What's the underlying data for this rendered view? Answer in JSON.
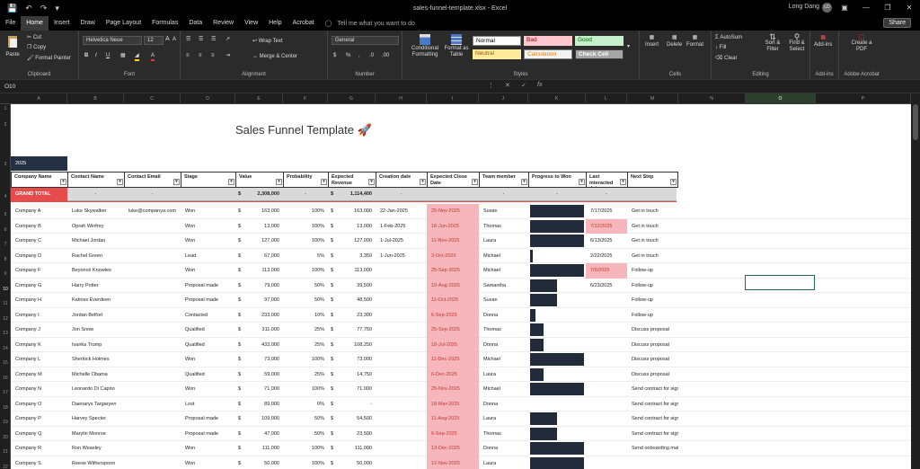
{
  "window": {
    "doc_title": "sales-funnel-template.xlsx  -  Excel",
    "user_name": "Long Dang",
    "user_initials": "LD"
  },
  "tabs": [
    "File",
    "Home",
    "Insert",
    "Draw",
    "Page Layout",
    "Formulas",
    "Data",
    "Review",
    "View",
    "Help",
    "Acrobat"
  ],
  "tell_me": "Tell me what you want to do",
  "share_label": "Share",
  "ribbon": {
    "clipboard": {
      "label": "Clipboard",
      "paste": "Paste",
      "cut": "Cut",
      "copy": "Copy",
      "format_painter": "Format Painter"
    },
    "font": {
      "label": "Font",
      "name": "Helvetica Neue",
      "size": "12"
    },
    "alignment": {
      "label": "Alignment",
      "wrap": "Wrap Text",
      "merge": "Merge & Center"
    },
    "number": {
      "label": "Number",
      "format": "General"
    },
    "styles": {
      "label": "Styles",
      "conditional": "Conditional Formatting",
      "format_table": "Format as Table",
      "normal": "Normal",
      "bad": "Bad",
      "good": "Good",
      "neutral": "Neutral",
      "calculation": "Calculation",
      "check_cell": "Check Cell"
    },
    "cells": {
      "label": "Cells",
      "insert": "Insert",
      "delete": "Delete",
      "format": "Format"
    },
    "editing": {
      "label": "Editing",
      "autosum": "AutoSum",
      "fill": "Fill",
      "clear": "Clear",
      "sort": "Sort & Filter",
      "find": "Find & Select"
    },
    "addins": {
      "label": "Add-ins",
      "btn": "Add-ins"
    },
    "acrobat": {
      "label": "Adobe Acrobat",
      "btn": "Create a PDF"
    }
  },
  "name_box": "O10",
  "columns": [
    "A",
    "B",
    "C",
    "D",
    "E",
    "F",
    "G",
    "H",
    "I",
    "J",
    "K",
    "L",
    "M",
    "N",
    "O",
    "P"
  ],
  "rows": [
    "1",
    "2",
    "3",
    "4",
    "5",
    "6",
    "7",
    "8",
    "9",
    "10",
    "11",
    "12",
    "13",
    "14",
    "15",
    "16",
    "17",
    "18",
    "19",
    "20",
    "21",
    "22"
  ],
  "sheet": {
    "title": "Sales Funnel Template 🚀",
    "year": "2025",
    "headers": [
      "Company Name",
      "Contact Name",
      "Contact Email",
      "Stage",
      "Value",
      "Probability",
      "Expected Revenue",
      "Creation date",
      "Expected Close Date",
      "Team member",
      "Progress to Won",
      "Last interacted date",
      "Next Step"
    ],
    "grand_total": {
      "label": "GRAND TOTAL",
      "value": "2,308,000",
      "revenue": "1,114,400"
    },
    "data": [
      {
        "company": "Company A",
        "contact": "Luke Skywalker",
        "email": "luke@companya.com",
        "stage": "Won",
        "value": "163,000",
        "prob": "100%",
        "rev": "163,000",
        "created": "22-Jan-2025",
        "close": "25-Nov-2025",
        "member": "Susan",
        "progress": 1.0,
        "last": "7/17/2025",
        "last_hl": false,
        "next": "Get in touch"
      },
      {
        "company": "Company B",
        "contact": "Oprah Winfrey",
        "email": "",
        "stage": "Won",
        "value": "13,000",
        "prob": "100%",
        "rev": "13,000",
        "created": "1-Feb-2025",
        "close": "18-Jun-2025",
        "member": "Thomas",
        "progress": 1.0,
        "last": "7/12/2025",
        "last_hl": true,
        "next": "Get in touch"
      },
      {
        "company": "Company C",
        "contact": "Michael Jordan",
        "email": "",
        "stage": "Won",
        "value": "127,000",
        "prob": "100%",
        "rev": "127,000",
        "created": "1-Jul-2025",
        "close": "11-Nov-2025",
        "member": "Laura",
        "progress": 1.0,
        "last": "6/13/2025",
        "last_hl": false,
        "next": "Get in touch"
      },
      {
        "company": "Company D",
        "contact": "Rachel Green",
        "email": "",
        "stage": "Lead",
        "value": "67,000",
        "prob": "5%",
        "rev": "3,350",
        "created": "1-Jun-2025",
        "close": "3-Oct-2025",
        "member": "Michael",
        "progress": 0.05,
        "last": "2/22/2025",
        "last_hl": false,
        "next": "Get in touch"
      },
      {
        "company": "Company F",
        "contact": "Beyoncé Knowles",
        "email": "",
        "stage": "Won",
        "value": "113,000",
        "prob": "100%",
        "rev": "113,000",
        "created": "",
        "close": "25-Sep-2025",
        "member": "Michael",
        "progress": 1.0,
        "last": "7/5/2025",
        "last_hl": true,
        "next": "Follow-up"
      },
      {
        "company": "Company G",
        "contact": "Harry Potter",
        "email": "",
        "stage": "Proposal made",
        "value": "79,000",
        "prob": "50%",
        "rev": "39,500",
        "created": "",
        "close": "19-Aug-2025",
        "member": "Samantha",
        "progress": 0.5,
        "last": "6/23/2025",
        "last_hl": false,
        "next": "Follow-up"
      },
      {
        "company": "Company H",
        "contact": "Katniss Everdeen",
        "email": "",
        "stage": "Proposal made",
        "value": "97,000",
        "prob": "50%",
        "rev": "48,500",
        "created": "",
        "close": "11-Oct-2025",
        "member": "Susan",
        "progress": 0.5,
        "last": "",
        "last_hl": false,
        "next": "Follow-up"
      },
      {
        "company": "Company I",
        "contact": "Jordan Belfort",
        "email": "",
        "stage": "Contacted",
        "value": "233,000",
        "prob": "10%",
        "rev": "23,300",
        "created": "",
        "close": "6-Sep-2025",
        "member": "Donna",
        "progress": 0.1,
        "last": "",
        "last_hl": false,
        "next": "Follow-up"
      },
      {
        "company": "Company J",
        "contact": "Jon Snow",
        "email": "",
        "stage": "Qualified",
        "value": "311,000",
        "prob": "25%",
        "rev": "77,750",
        "created": "",
        "close": "25-Sep-2025",
        "member": "Thomas",
        "progress": 0.25,
        "last": "",
        "last_hl": false,
        "next": "Discuss proposal"
      },
      {
        "company": "Company K",
        "contact": "Ivanka Trump",
        "email": "",
        "stage": "Qualified",
        "value": "433,000",
        "prob": "25%",
        "rev": "108,250",
        "created": "",
        "close": "18-Jul-2025",
        "member": "Donna",
        "progress": 0.25,
        "last": "",
        "last_hl": false,
        "next": "Discuss proposal"
      },
      {
        "company": "Company L",
        "contact": "Sherlock Holmes",
        "email": "",
        "stage": "Won",
        "value": "73,000",
        "prob": "100%",
        "rev": "73,000",
        "created": "",
        "close": "11-Dec-2025",
        "member": "Michael",
        "progress": 1.0,
        "last": "",
        "last_hl": false,
        "next": "Discuss proposal"
      },
      {
        "company": "Company M",
        "contact": "Michelle Obama",
        "email": "",
        "stage": "Qualified",
        "value": "59,000",
        "prob": "25%",
        "rev": "14,750",
        "created": "",
        "close": "6-Dec-2025",
        "member": "Laura",
        "progress": 0.25,
        "last": "",
        "last_hl": false,
        "next": "Discuss proposal"
      },
      {
        "company": "Company N",
        "contact": "Leonardo Di Caprio",
        "email": "",
        "stage": "Won",
        "value": "71,000",
        "prob": "100%",
        "rev": "71,000",
        "created": "",
        "close": "25-Nov-2025",
        "member": "Michael",
        "progress": 1.0,
        "last": "",
        "last_hl": false,
        "next": "Send contract for signing"
      },
      {
        "company": "Company O",
        "contact": "Daenarys Targaryen",
        "email": "",
        "stage": "Lost",
        "value": "89,000",
        "prob": "0%",
        "rev": "-",
        "created": "",
        "close": "18-Mar-2025",
        "member": "Donna",
        "progress": 0.0,
        "last": "",
        "last_hl": false,
        "next": "Send contract for signing"
      },
      {
        "company": "Company P",
        "contact": "Harvey Specter",
        "email": "",
        "stage": "Proposal made",
        "value": "109,000",
        "prob": "50%",
        "rev": "54,500",
        "created": "",
        "close": "11-Aug-2025",
        "member": "Laura",
        "progress": 0.5,
        "last": "",
        "last_hl": false,
        "next": "Send contract for signing"
      },
      {
        "company": "Company Q",
        "contact": "Marylin Monroe",
        "email": "",
        "stage": "Proposal made",
        "value": "47,000",
        "prob": "50%",
        "rev": "23,500",
        "created": "",
        "close": "6-Sep-2025",
        "member": "Thomas",
        "progress": 0.5,
        "last": "",
        "last_hl": false,
        "next": "Send contract for signing"
      },
      {
        "company": "Company R",
        "contact": "Ron Weasley",
        "email": "",
        "stage": "Won",
        "value": "111,000",
        "prob": "100%",
        "rev": "111,000",
        "created": "",
        "close": "13-Dec-2025",
        "member": "Donna",
        "progress": 1.0,
        "last": "",
        "last_hl": false,
        "next": "Send onboarding material"
      },
      {
        "company": "Company S",
        "contact": "Reese Witherspoon",
        "email": "",
        "stage": "Won",
        "value": "50,000",
        "prob": "100%",
        "rev": "50,000",
        "created": "",
        "close": "12-Nov-2025",
        "member": "Laura",
        "progress": 1.0,
        "last": "",
        "last_hl": false,
        "next": ""
      }
    ]
  },
  "colors": {
    "navy": "#243043",
    "grand_total_red": "#e74c4c",
    "close_pink": "#f6b6bb",
    "selection": "#1e7145"
  }
}
